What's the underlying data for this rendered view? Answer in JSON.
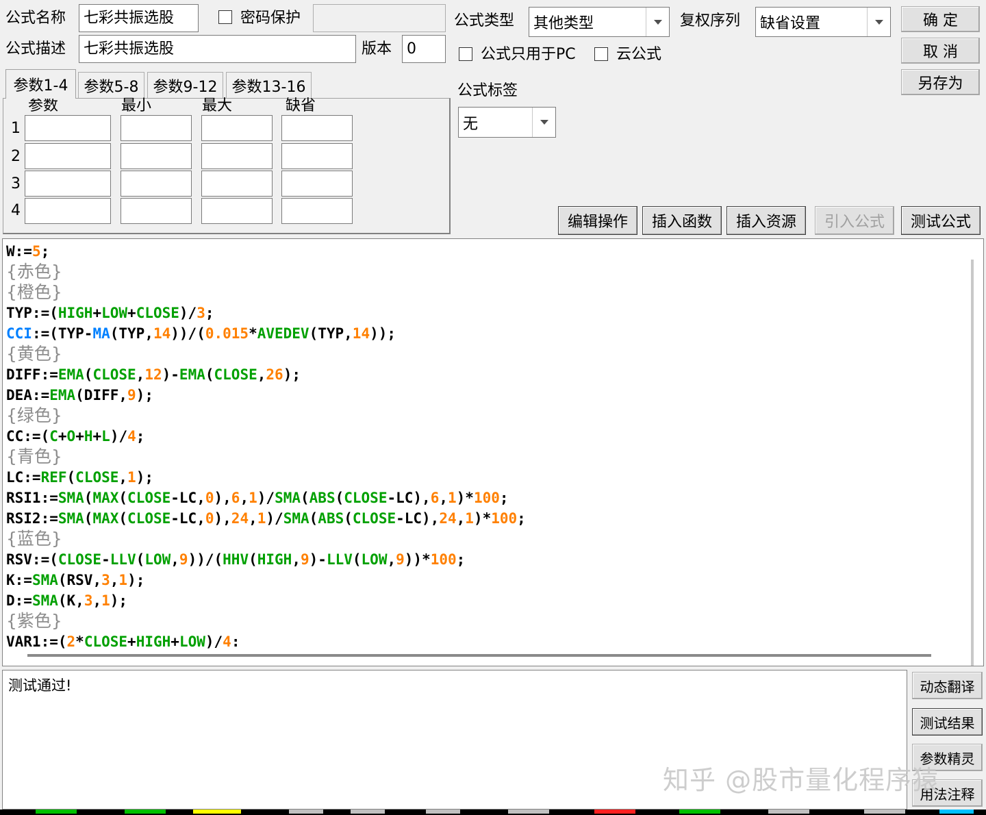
{
  "labels": {
    "formula_name": "公式名称",
    "password": "密码保护",
    "formula_desc": "公式描述",
    "version": "版本",
    "formula_type": "公式类型",
    "rights_seq": "复权序列",
    "pc_only": "公式只用于PC",
    "cloud": "云公式",
    "formula_tag": "公式标签"
  },
  "values": {
    "formula_name": "七彩共振选股",
    "formula_desc": "七彩共振选股",
    "version": "0",
    "password": "",
    "formula_type": "其他类型",
    "rights_seq": "缺省设置",
    "formula_tag": "无"
  },
  "buttons": {
    "ok": "确 定",
    "cancel": "取 消",
    "save_as": "另存为",
    "edit_ops": "编辑操作",
    "insert_func": "插入函数",
    "insert_res": "插入资源",
    "import_formula": "引入公式",
    "test_formula": "测试公式",
    "dynamic_translate": "动态翻译",
    "test_result": "测试结果",
    "param_wizard": "参数精灵",
    "usage_notes": "用法注释"
  },
  "tabs": [
    "参数1-4",
    "参数5-8",
    "参数9-12",
    "参数13-16"
  ],
  "param_table": {
    "headers": [
      "参数",
      "最小",
      "最大",
      "缺省"
    ],
    "rows": [
      "1",
      "2",
      "3",
      "4"
    ]
  },
  "code_lines": [
    [
      [
        "k",
        "W:="
      ],
      [
        "n",
        "5"
      ],
      [
        "k",
        ";"
      ]
    ],
    [
      [
        "c",
        "{赤色}"
      ]
    ],
    [
      [
        "c",
        "{橙色}"
      ]
    ],
    [
      [
        "k",
        "TYP:=("
      ],
      [
        "f",
        "HIGH"
      ],
      [
        "k",
        "+"
      ],
      [
        "f",
        "LOW"
      ],
      [
        "k",
        "+"
      ],
      [
        "f",
        "CLOSE"
      ],
      [
        "k",
        ")/"
      ],
      [
        "n",
        "3"
      ],
      [
        "k",
        ";"
      ]
    ],
    [
      [
        "b",
        "CCI"
      ],
      [
        "k",
        ":=(TYP-"
      ],
      [
        "b",
        "MA"
      ],
      [
        "k",
        "(TYP,"
      ],
      [
        "n",
        "14"
      ],
      [
        "k",
        "))/("
      ],
      [
        "n",
        "0.015"
      ],
      [
        "k",
        "*"
      ],
      [
        "f",
        "AVEDEV"
      ],
      [
        "k",
        "(TYP,"
      ],
      [
        "n",
        "14"
      ],
      [
        "k",
        "));"
      ]
    ],
    [
      [
        "c",
        "{黄色}"
      ]
    ],
    [
      [
        "k",
        "DIFF:="
      ],
      [
        "f",
        "EMA"
      ],
      [
        "k",
        "("
      ],
      [
        "f",
        "CLOSE"
      ],
      [
        "k",
        ","
      ],
      [
        "n",
        "12"
      ],
      [
        "k",
        ")-"
      ],
      [
        "f",
        "EMA"
      ],
      [
        "k",
        "("
      ],
      [
        "f",
        "CLOSE"
      ],
      [
        "k",
        ","
      ],
      [
        "n",
        "26"
      ],
      [
        "k",
        ");"
      ]
    ],
    [
      [
        "k",
        "DEA:="
      ],
      [
        "f",
        "EMA"
      ],
      [
        "k",
        "(DIFF,"
      ],
      [
        "n",
        "9"
      ],
      [
        "k",
        ");"
      ]
    ],
    [
      [
        "c",
        "{绿色}"
      ]
    ],
    [
      [
        "k",
        "CC:=("
      ],
      [
        "f",
        "C"
      ],
      [
        "k",
        "+"
      ],
      [
        "f",
        "O"
      ],
      [
        "k",
        "+"
      ],
      [
        "f",
        "H"
      ],
      [
        "k",
        "+"
      ],
      [
        "f",
        "L"
      ],
      [
        "k",
        ")/"
      ],
      [
        "n",
        "4"
      ],
      [
        "k",
        ";"
      ]
    ],
    [
      [
        "c",
        "{青色}"
      ]
    ],
    [
      [
        "k",
        "LC:="
      ],
      [
        "f",
        "REF"
      ],
      [
        "k",
        "("
      ],
      [
        "f",
        "CLOSE"
      ],
      [
        "k",
        ","
      ],
      [
        "n",
        "1"
      ],
      [
        "k",
        ");"
      ]
    ],
    [
      [
        "k",
        "RSI1:="
      ],
      [
        "f",
        "SMA"
      ],
      [
        "k",
        "("
      ],
      [
        "f",
        "MAX"
      ],
      [
        "k",
        "("
      ],
      [
        "f",
        "CLOSE"
      ],
      [
        "k",
        "-LC,"
      ],
      [
        "n",
        "0"
      ],
      [
        "k",
        "),"
      ],
      [
        "n",
        "6"
      ],
      [
        "k",
        ","
      ],
      [
        "n",
        "1"
      ],
      [
        "k",
        ")/"
      ],
      [
        "f",
        "SMA"
      ],
      [
        "k",
        "("
      ],
      [
        "f",
        "ABS"
      ],
      [
        "k",
        "("
      ],
      [
        "f",
        "CLOSE"
      ],
      [
        "k",
        "-LC),"
      ],
      [
        "n",
        "6"
      ],
      [
        "k",
        ","
      ],
      [
        "n",
        "1"
      ],
      [
        "k",
        ")*"
      ],
      [
        "n",
        "100"
      ],
      [
        "k",
        ";"
      ]
    ],
    [
      [
        "k",
        "RSI2:="
      ],
      [
        "f",
        "SMA"
      ],
      [
        "k",
        "("
      ],
      [
        "f",
        "MAX"
      ],
      [
        "k",
        "("
      ],
      [
        "f",
        "CLOSE"
      ],
      [
        "k",
        "-LC,"
      ],
      [
        "n",
        "0"
      ],
      [
        "k",
        "),"
      ],
      [
        "n",
        "24"
      ],
      [
        "k",
        ","
      ],
      [
        "n",
        "1"
      ],
      [
        "k",
        ")/"
      ],
      [
        "f",
        "SMA"
      ],
      [
        "k",
        "("
      ],
      [
        "f",
        "ABS"
      ],
      [
        "k",
        "("
      ],
      [
        "f",
        "CLOSE"
      ],
      [
        "k",
        "-LC),"
      ],
      [
        "n",
        "24"
      ],
      [
        "k",
        ","
      ],
      [
        "n",
        "1"
      ],
      [
        "k",
        ")*"
      ],
      [
        "n",
        "100"
      ],
      [
        "k",
        ";"
      ]
    ],
    [
      [
        "c",
        "{蓝色}"
      ]
    ],
    [
      [
        "k",
        "RSV:=("
      ],
      [
        "f",
        "CLOSE"
      ],
      [
        "k",
        "-"
      ],
      [
        "f",
        "LLV"
      ],
      [
        "k",
        "("
      ],
      [
        "f",
        "LOW"
      ],
      [
        "k",
        ","
      ],
      [
        "n",
        "9"
      ],
      [
        "k",
        "))/("
      ],
      [
        "f",
        "HHV"
      ],
      [
        "k",
        "("
      ],
      [
        "f",
        "HIGH"
      ],
      [
        "k",
        ","
      ],
      [
        "n",
        "9"
      ],
      [
        "k",
        ")-"
      ],
      [
        "f",
        "LLV"
      ],
      [
        "k",
        "("
      ],
      [
        "f",
        "LOW"
      ],
      [
        "k",
        ","
      ],
      [
        "n",
        "9"
      ],
      [
        "k",
        "))*"
      ],
      [
        "n",
        "100"
      ],
      [
        "k",
        ";"
      ]
    ],
    [
      [
        "k",
        "K:="
      ],
      [
        "f",
        "SMA"
      ],
      [
        "k",
        "(RSV,"
      ],
      [
        "n",
        "3"
      ],
      [
        "k",
        ","
      ],
      [
        "n",
        "1"
      ],
      [
        "k",
        ");"
      ]
    ],
    [
      [
        "k",
        "D:="
      ],
      [
        "f",
        "SMA"
      ],
      [
        "k",
        "(K,"
      ],
      [
        "n",
        "3"
      ],
      [
        "k",
        ","
      ],
      [
        "n",
        "1"
      ],
      [
        "k",
        ");"
      ]
    ],
    [
      [
        "c",
        "{紫色}"
      ]
    ],
    [
      [
        "k",
        "VAR1:=("
      ],
      [
        "n",
        "2"
      ],
      [
        "k",
        "*"
      ],
      [
        "f",
        "CLOSE"
      ],
      [
        "k",
        "+"
      ],
      [
        "f",
        "HIGH"
      ],
      [
        "k",
        "+"
      ],
      [
        "f",
        "LOW"
      ],
      [
        "k",
        ")/"
      ],
      [
        "n",
        "4"
      ],
      [
        "k",
        ":"
      ]
    ]
  ],
  "result_text": "测试通过!",
  "watermark": "知乎 @股市量化程序猿",
  "colors": {
    "keyword": "#000000",
    "function": "#00a000",
    "number": "#ff8000",
    "builtin": "#0080ff",
    "comment": "#8c8c8c"
  }
}
